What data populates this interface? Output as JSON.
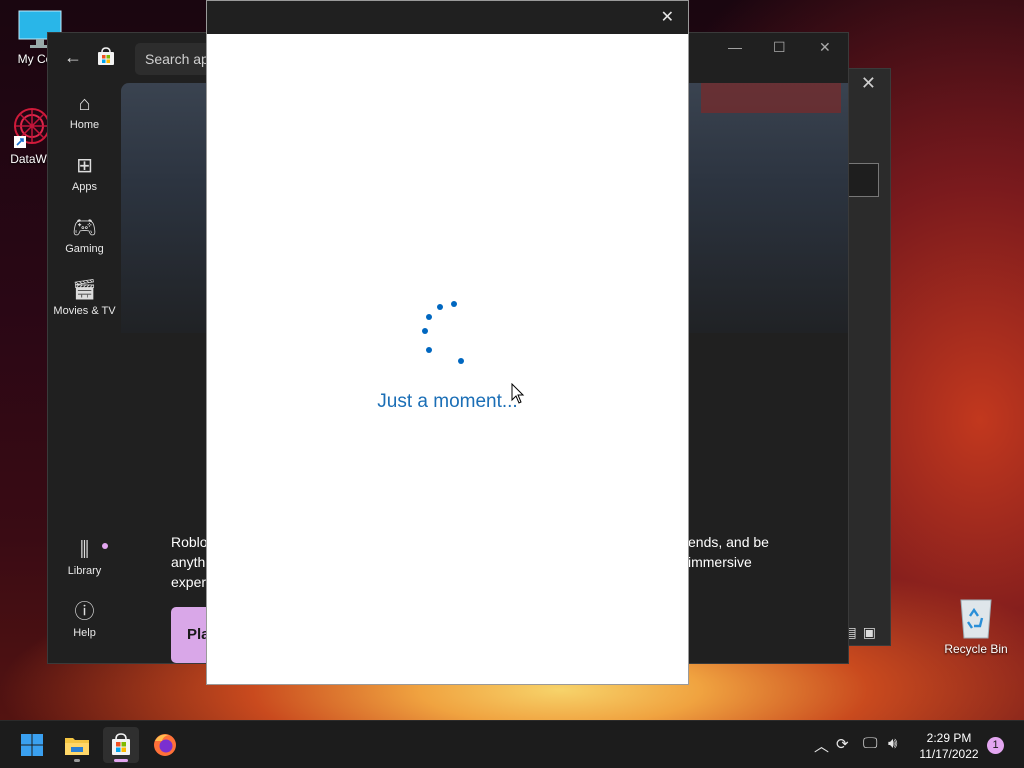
{
  "desktop": {
    "icons": [
      {
        "label": "My Com",
        "name": "my-computer"
      },
      {
        "label": "DataWag",
        "name": "datawag"
      },
      {
        "label": "Recycle Bin",
        "name": "recycle-bin"
      }
    ]
  },
  "store": {
    "search_placeholder": "Search ap",
    "nav": [
      {
        "label": "Home",
        "icon": "home-icon"
      },
      {
        "label": "Apps",
        "icon": "apps-icon"
      },
      {
        "label": "Gaming",
        "icon": "gamepad-icon"
      },
      {
        "label": "Movies & TV",
        "icon": "clapperboard-icon"
      }
    ],
    "nav_bottom": [
      {
        "label": "Library",
        "icon": "library-icon"
      },
      {
        "label": "Help",
        "icon": "help-icon"
      }
    ],
    "description_left": [
      "Roblo",
      "anythi",
      "experi"
    ],
    "description_right": [
      "ends, and be",
      "immersive"
    ],
    "play_label": "Pla"
  },
  "modal": {
    "loading_text": "Just a moment..."
  },
  "taskbar": {
    "time": "2:29 PM",
    "date": "11/17/2022",
    "notification_count": "1"
  },
  "colors": {
    "accent": "#0067c0",
    "loading_text": "#1a6eb6",
    "store_accent": "#e3a6f0"
  }
}
